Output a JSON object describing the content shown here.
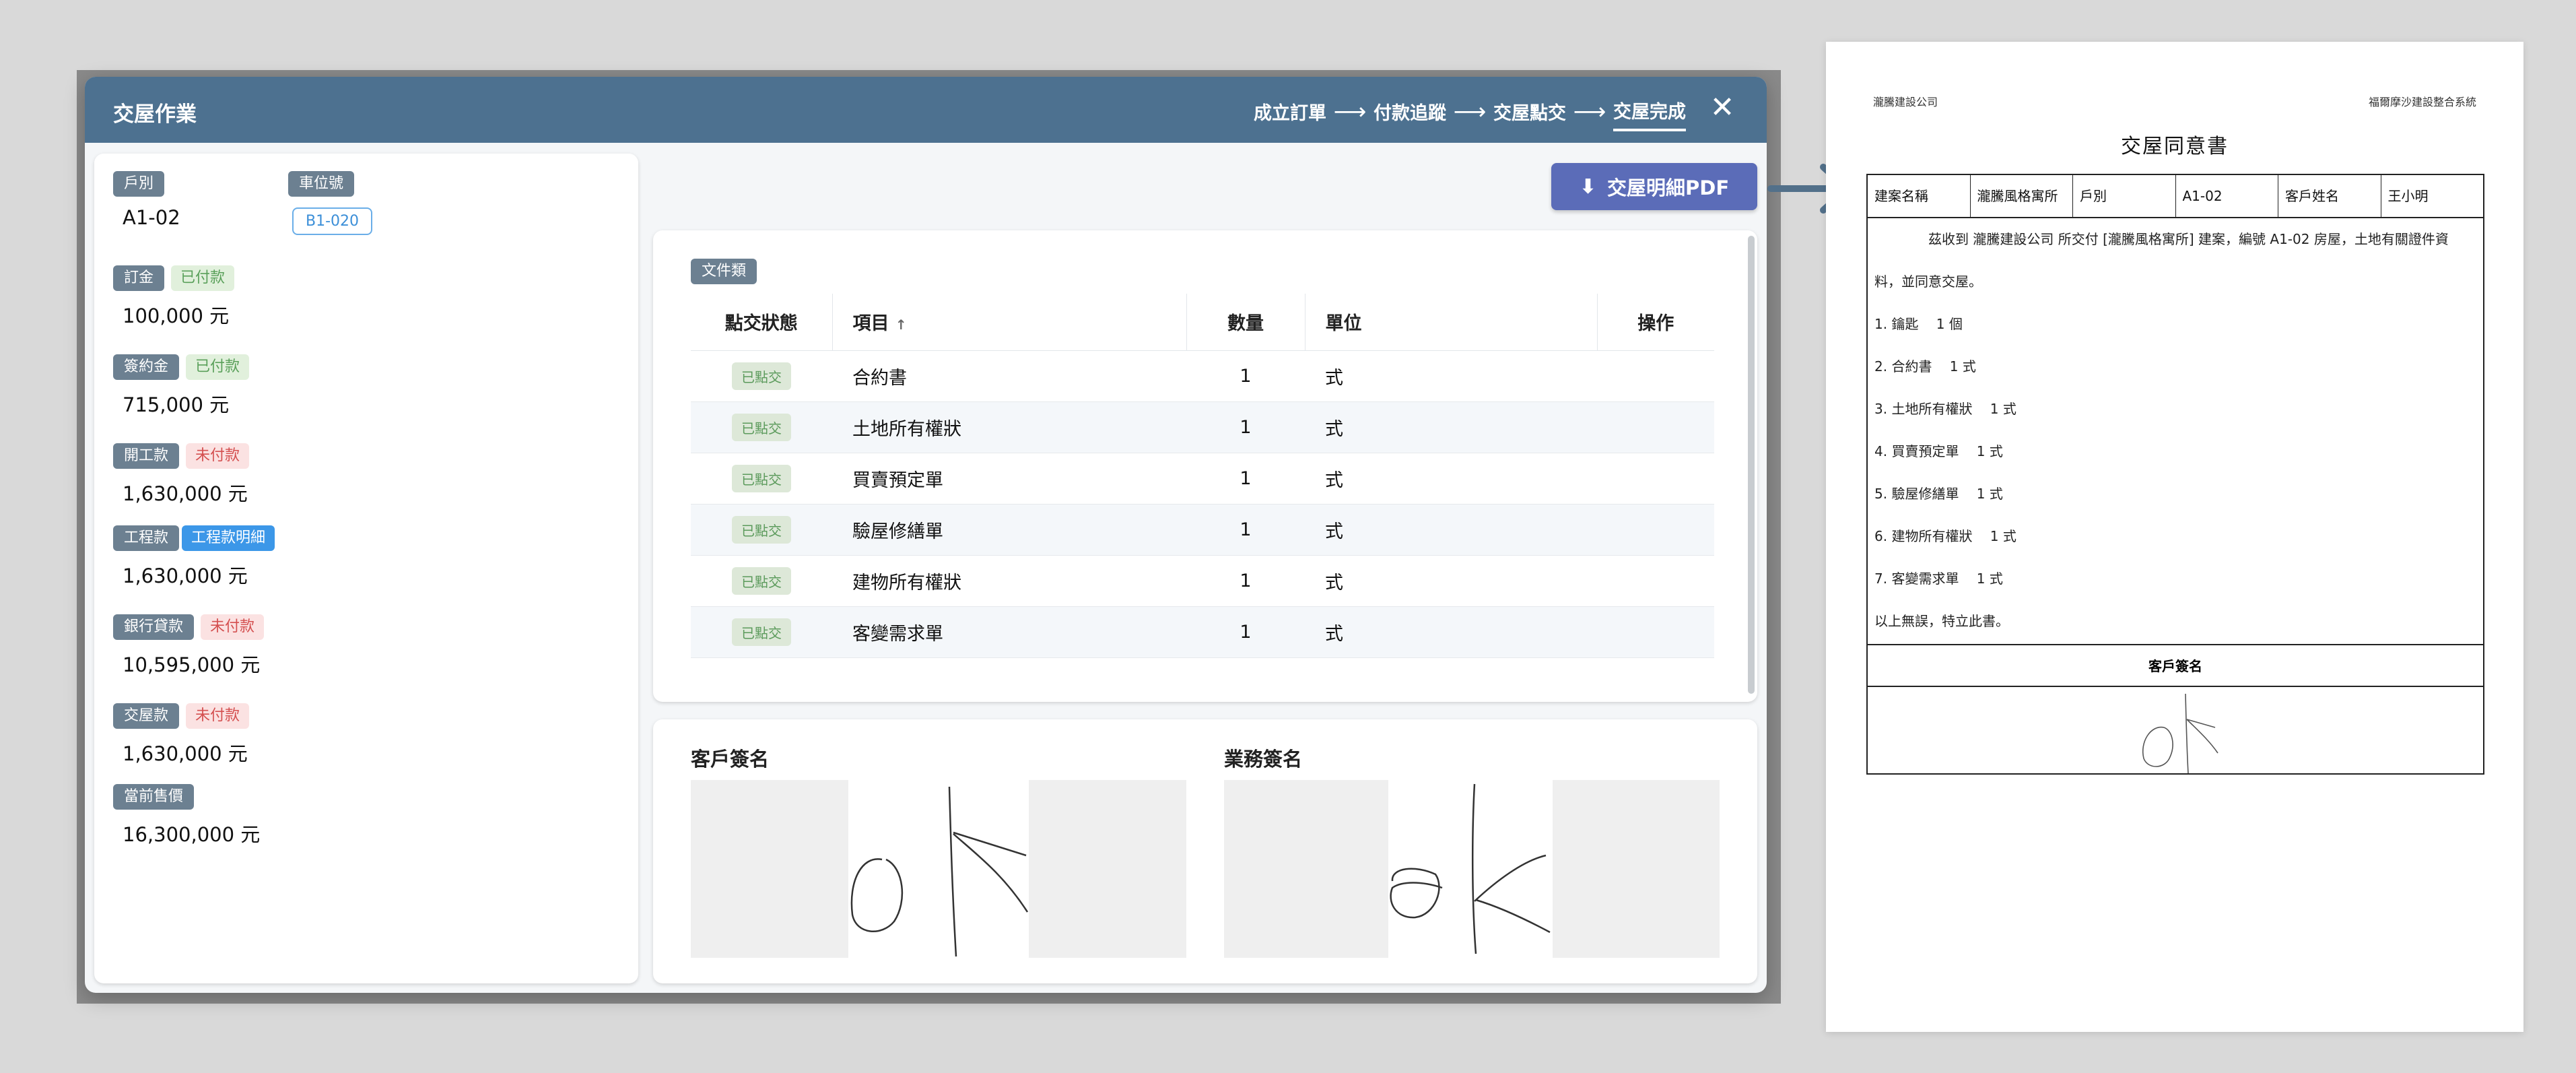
{
  "modal": {
    "title": "交屋作業",
    "steps": [
      "成立訂單",
      "付款追蹤",
      "交屋點交",
      "交屋完成"
    ],
    "active_step": "交屋完成",
    "close_icon": "close-icon"
  },
  "left": {
    "unit_label": "戶別",
    "unit_value": "A1-02",
    "parking_label": "車位號",
    "parking_value": "B1-020",
    "payments": [
      {
        "label": "訂金",
        "status": "已付款",
        "status_type": "paid",
        "amount": "100,000 元"
      },
      {
        "label": "簽約金",
        "status": "已付款",
        "status_type": "paid",
        "amount": "715,000 元"
      },
      {
        "label": "開工款",
        "status": "未付款",
        "status_type": "unpaid",
        "amount": "1,630,000 元"
      },
      {
        "label": "工程款",
        "status": "工程款明細",
        "status_type": "link",
        "amount": "1,630,000 元"
      },
      {
        "label": "銀行貸款",
        "status": "未付款",
        "status_type": "unpaid",
        "amount": "10,595,000 元"
      },
      {
        "label": "交屋款",
        "status": "未付款",
        "status_type": "unpaid",
        "amount": "1,630,000 元"
      },
      {
        "label": "當前售價",
        "status": "",
        "status_type": "none",
        "amount": "16,300,000 元"
      }
    ]
  },
  "pdf_button": {
    "label": "交屋明細PDF",
    "icon": "download-icon"
  },
  "docs": {
    "chip": "文件類",
    "columns": [
      "點交狀態",
      "項目",
      "數量",
      "單位",
      "操作"
    ],
    "sort_indicator": "↑",
    "rows": [
      {
        "status": "已點交",
        "item": "合約書",
        "qty": "1",
        "unit": "式"
      },
      {
        "status": "已點交",
        "item": "土地所有權狀",
        "qty": "1",
        "unit": "式"
      },
      {
        "status": "已點交",
        "item": "買賣預定單",
        "qty": "1",
        "unit": "式"
      },
      {
        "status": "已點交",
        "item": "驗屋修繕單",
        "qty": "1",
        "unit": "式"
      },
      {
        "status": "已點交",
        "item": "建物所有權狀",
        "qty": "1",
        "unit": "式"
      },
      {
        "status": "已點交",
        "item": "客變需求單",
        "qty": "1",
        "unit": "式"
      }
    ]
  },
  "signatures": {
    "customer_label": "客戶簽名",
    "sales_label": "業務簽名"
  },
  "document": {
    "company": "瀧騰建設公司",
    "system": "福爾摩沙建設整合系統",
    "title": "交屋同意書",
    "info": [
      "建案名稱",
      "瀧騰風格寓所",
      "戶別",
      "A1-02",
      "客戶姓名",
      "王小明"
    ],
    "intro": "茲收到 瀧騰建設公司 所交付 [瀧騰風格寓所] 建案，編號 A1-02 房屋，土地有關證件資",
    "intro2": "料，並同意交屋。",
    "items": [
      "1. 鑰匙　 1 個",
      "2. 合約書　 1 式",
      "3. 土地所有權狀　 1 式",
      "4. 買賣預定單　 1 式",
      "5. 驗屋修繕單　 1 式",
      "6. 建物所有權狀　 1 式",
      "7. 客變需求單　 1 式"
    ],
    "closing": "以上無誤，特立此書。",
    "sign_header": "客戶簽名"
  }
}
